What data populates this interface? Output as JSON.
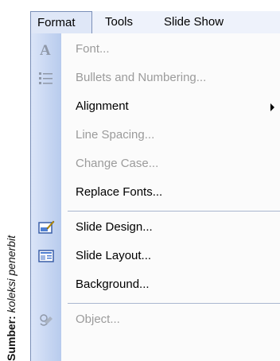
{
  "caption": {
    "label": "Sumber:",
    "source": "koleksi penerbit"
  },
  "menubar": {
    "items": [
      {
        "label": "Format"
      },
      {
        "label": "Tools"
      },
      {
        "label": "Slide Show"
      }
    ]
  },
  "menu": {
    "items": [
      {
        "label": "Font...",
        "icon": "font-icon",
        "enabled": false
      },
      {
        "label": "Bullets and Numbering...",
        "icon": "bullets-icon",
        "enabled": false
      },
      {
        "label": "Alignment",
        "icon": "",
        "enabled": true,
        "submenu": true
      },
      {
        "label": "Line Spacing...",
        "icon": "",
        "enabled": false
      },
      {
        "label": "Change Case...",
        "icon": "",
        "enabled": false
      },
      {
        "label": "Replace Fonts...",
        "icon": "",
        "enabled": true
      },
      {
        "label": "Slide Design...",
        "icon": "slide-design-icon",
        "enabled": true
      },
      {
        "label": "Slide Layout...",
        "icon": "slide-layout-icon",
        "enabled": true
      },
      {
        "label": "Background...",
        "icon": "",
        "enabled": true
      },
      {
        "label": "Object...",
        "icon": "object-icon",
        "enabled": false
      }
    ]
  },
  "colors": {
    "menubar_bg": "#eef2fb",
    "gutter_start": "#dbe5f8",
    "gutter_end": "#b8cbed",
    "disabled_text": "#9b9b9b",
    "border": "#7a8fb8"
  }
}
